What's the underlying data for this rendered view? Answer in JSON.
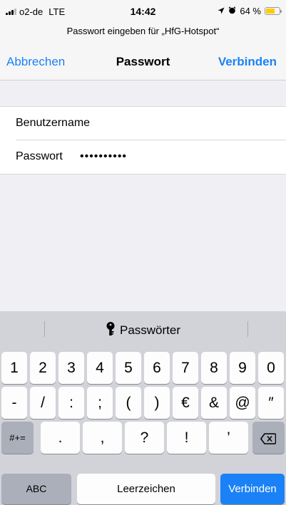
{
  "status_bar": {
    "carrier": "o2-de",
    "network": "LTE",
    "time": "14:42",
    "battery_text": "64 %",
    "battery_level": 0.64,
    "battery_color": "#ffcc00",
    "icons": [
      "signal-icon",
      "location-arrow-icon",
      "alarm-icon",
      "battery-icon"
    ]
  },
  "prompt": "Passwort eingeben für „HfG-Hotspot“",
  "nav": {
    "cancel_label": "Abbrechen",
    "title": "Passwort",
    "connect_label": "Verbinden",
    "accent_color": "#1a82f6"
  },
  "form": {
    "username_label": "Benutzername",
    "username_value": "",
    "password_label": "Passwort",
    "password_value": "••••••••••"
  },
  "keyboard": {
    "quicktype_label": "Passwörter",
    "row1": [
      "1",
      "2",
      "3",
      "4",
      "5",
      "6",
      "7",
      "8",
      "9",
      "0"
    ],
    "row2": [
      "-",
      "/",
      ":",
      ";",
      "(",
      ")",
      "€",
      "&",
      "@",
      "″"
    ],
    "row3": {
      "mode_key": "#+=",
      "keys": [
        ".",
        ",",
        "?",
        "!",
        "’"
      ],
      "delete_icon": "backspace-icon"
    },
    "row4": {
      "abc_key": "ABC",
      "space_key": "Leerzeichen",
      "return_key": "Verbinden"
    }
  }
}
